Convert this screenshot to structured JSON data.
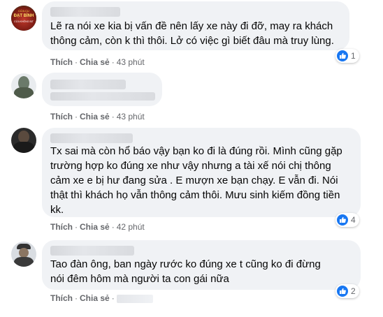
{
  "comments": [
    {
      "text": "Lẽ ra nói xe kia bị vấn đề nên lấy xe này đi đỡ, may ra khách thông cảm, còn k thì thôi. Lở có việc gì biết đâu mà truy lùng.",
      "like_label": "Thích",
      "share_label": "Chia sẻ",
      "time": "43 phút",
      "reaction_count": "1",
      "avatar_text_top": "CỬA CU",
      "avatar_text_mid": "ĐẠT BÌNH",
      "avatar_text_bottom": "CỬA KHÔNG BỊT"
    },
    {
      "text": "",
      "like_label": "Thích",
      "share_label": "Chia sẻ",
      "time": "43 phút"
    },
    {
      "text": "Tx sai mà còn hổ báo vậy bạn ko đi là đúng rồi. Mình cũng gặp trường hợp ko đúng xe như vậy nhưng a tài xế nói chị thông cảm xe e bị hư đang sửa . E mượn xe bạn chạy. E vẫn đi. Nói thật thì khách họ vẫn thông cảm thôi. Mưu sinh kiếm đồng tiền kk.",
      "like_label": "Thích",
      "share_label": "Chia sẻ",
      "time": "42 phút",
      "reaction_count": "4"
    },
    {
      "text": "Tao đàn ông, ban ngày rước ko đúng xe t cũng ko đi đừng nói đêm hôm mà người ta con gái nữa",
      "like_label": "Thích",
      "share_label": "Chia sẻ",
      "reaction_count": "2"
    }
  ],
  "icons": {
    "reaction": "like-thumb-icon"
  },
  "colors": {
    "bubble": "#f0f2f5",
    "meta": "#65676b",
    "like": "#1877f2"
  }
}
